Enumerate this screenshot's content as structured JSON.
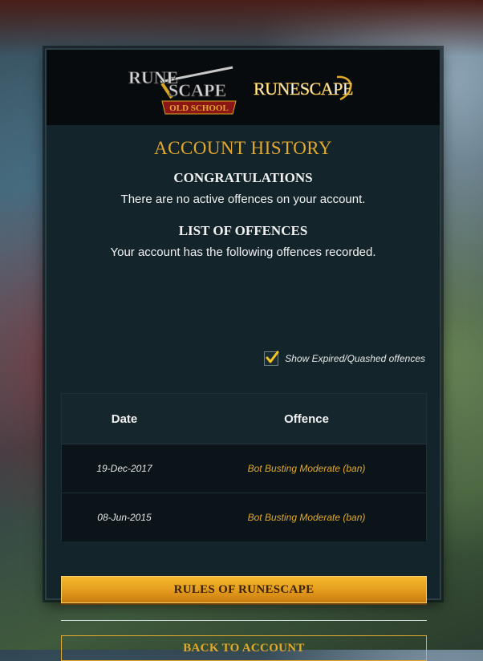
{
  "logos": {
    "osrs": {
      "line1": "RUNE",
      "line2": "SCAPE",
      "banner": "OLD SCHOOL"
    },
    "runescape": "RUNESCAPE"
  },
  "page": {
    "title": "ACCOUNT HISTORY",
    "congrats_heading": "CONGRATULATIONS",
    "congrats_text": "There are no active offences on your account.",
    "offences_heading": "LIST OF OFFENCES",
    "offences_text": "Your account has the following offences recorded."
  },
  "filter": {
    "show_expired_label": "Show Expired/Quashed offences",
    "checked": true
  },
  "table": {
    "headers": {
      "date": "Date",
      "offence": "Offence"
    },
    "rows": [
      {
        "date": "19-Dec-2017",
        "offence": "Bot Busting Moderate (ban)"
      },
      {
        "date": "08-Jun-2015",
        "offence": "Bot Busting Moderate (ban)"
      }
    ]
  },
  "buttons": {
    "rules": "RULES OF RUNESCAPE",
    "back": "BACK TO ACCOUNT"
  },
  "colors": {
    "accent_gold": "#e2a92d",
    "panel_bg": "#13242b",
    "text_light": "#f2f2f2"
  }
}
